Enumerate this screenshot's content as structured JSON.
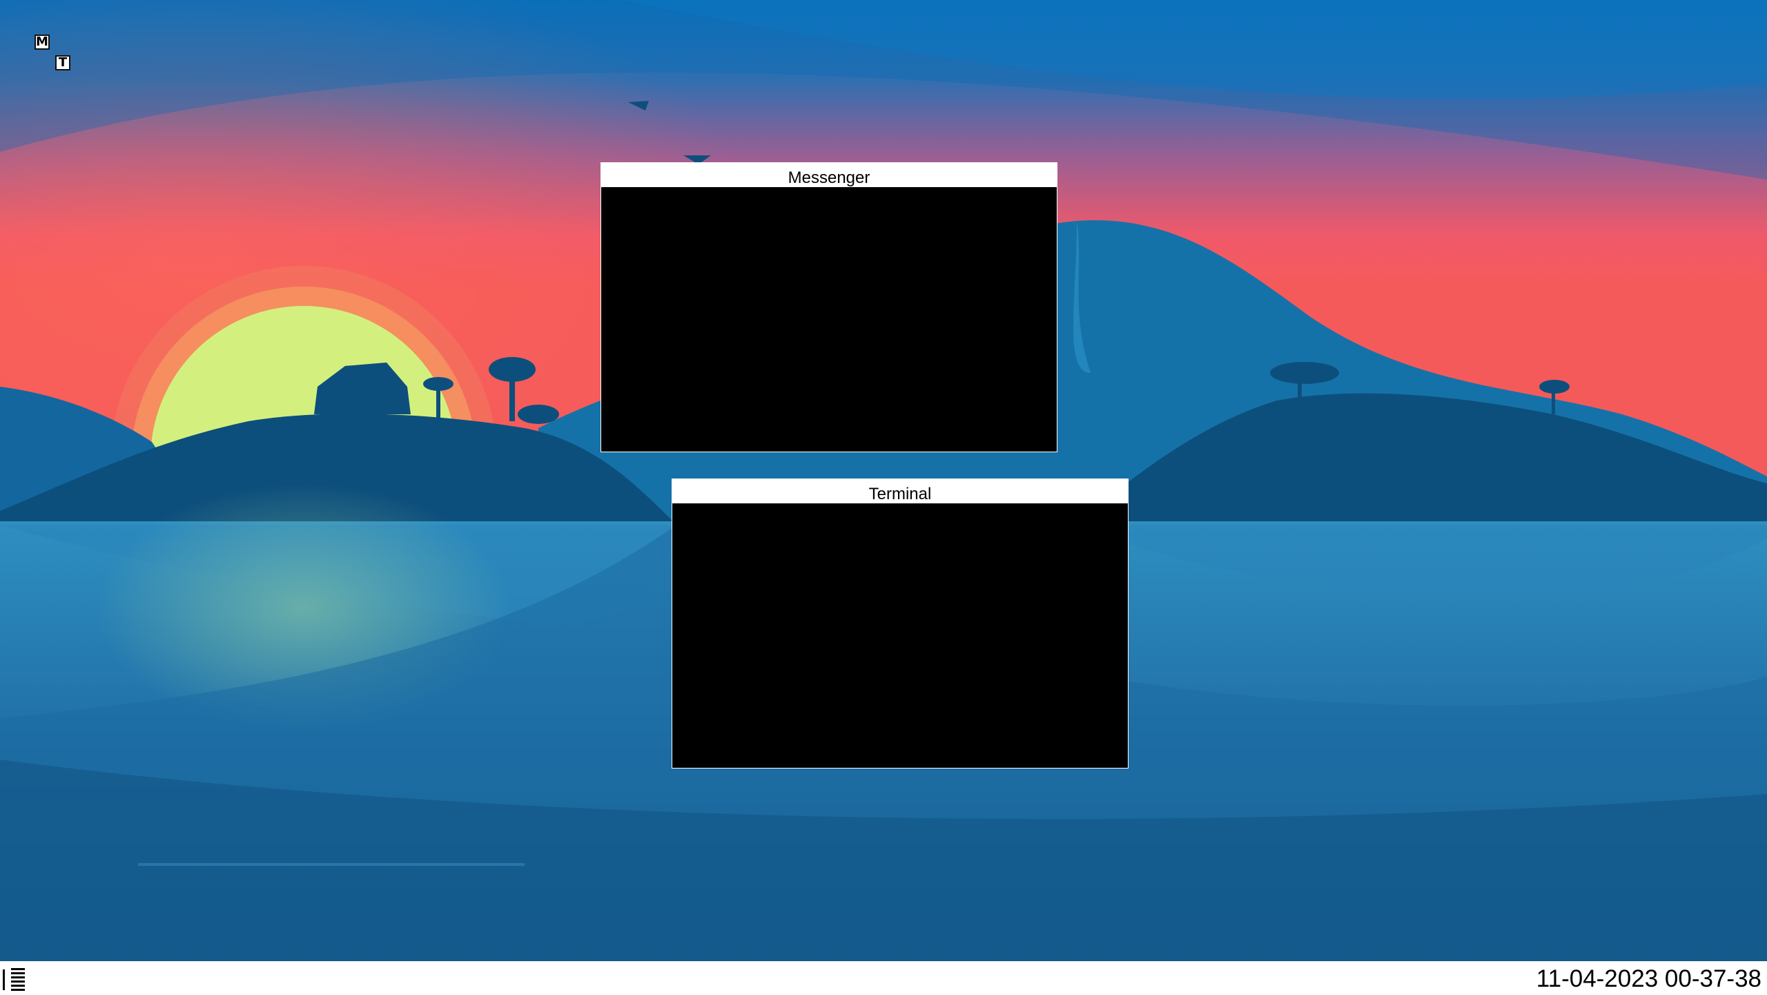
{
  "desktop": {
    "icons": [
      {
        "glyph": "M",
        "app": "Messenger"
      },
      {
        "glyph": "T",
        "app": "Terminal"
      }
    ]
  },
  "windows": [
    {
      "title": "Messenger"
    },
    {
      "title": "Terminal"
    }
  ],
  "taskbar": {
    "menu_icon": "menu-lines-icon",
    "clock": "11-04-2023 00-37-38"
  },
  "colors": {
    "window_body": "#000000",
    "titlebar": "#ffffff",
    "taskbar": "#ffffff",
    "sky_top": "#0a6fb8",
    "sunset": "#f0586a",
    "sun": "#d3f07e"
  }
}
